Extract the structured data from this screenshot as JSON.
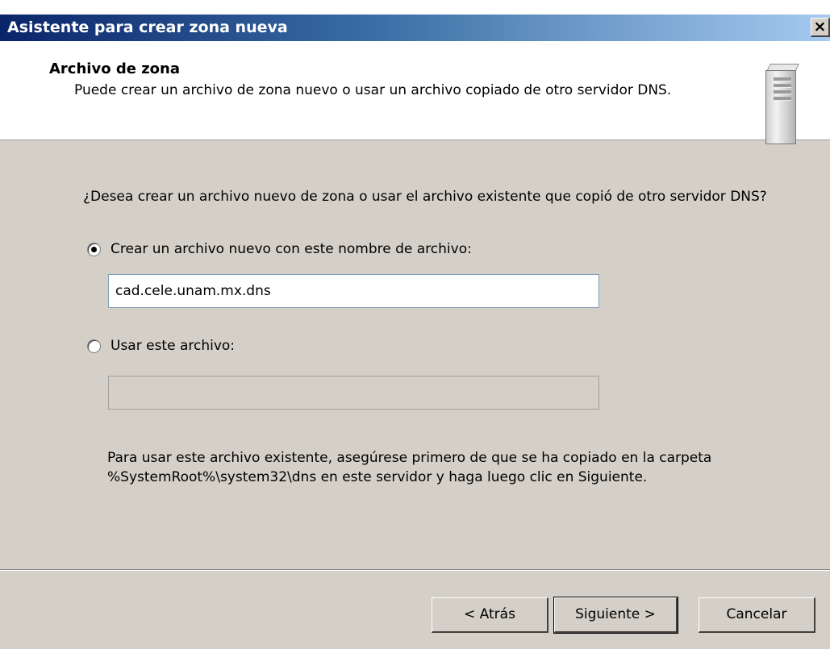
{
  "window": {
    "title": "Asistente para crear zona nueva",
    "close_label": "×"
  },
  "header": {
    "title": "Archivo de zona",
    "description": "Puede crear un archivo de zona nuevo o usar un archivo copiado de otro servidor DNS.",
    "icon": "server-icon"
  },
  "body": {
    "question": "¿Desea crear un archivo nuevo de zona o usar el archivo existente que copió de otro servidor DNS?",
    "option_new": {
      "label": "Crear un archivo nuevo con este nombre de archivo:",
      "selected": true,
      "value": "cad.cele.unam.mx.dns"
    },
    "option_existing": {
      "label": "Usar este archivo:",
      "selected": false,
      "value": ""
    },
    "note": "Para usar este archivo existente, asegúrese primero de que se ha copiado en la carpeta %SystemRoot%\\system32\\dns en este servidor y haga luego clic en Siguiente."
  },
  "buttons": {
    "back": "< Atrás",
    "next": "Siguiente >",
    "cancel": "Cancelar"
  }
}
